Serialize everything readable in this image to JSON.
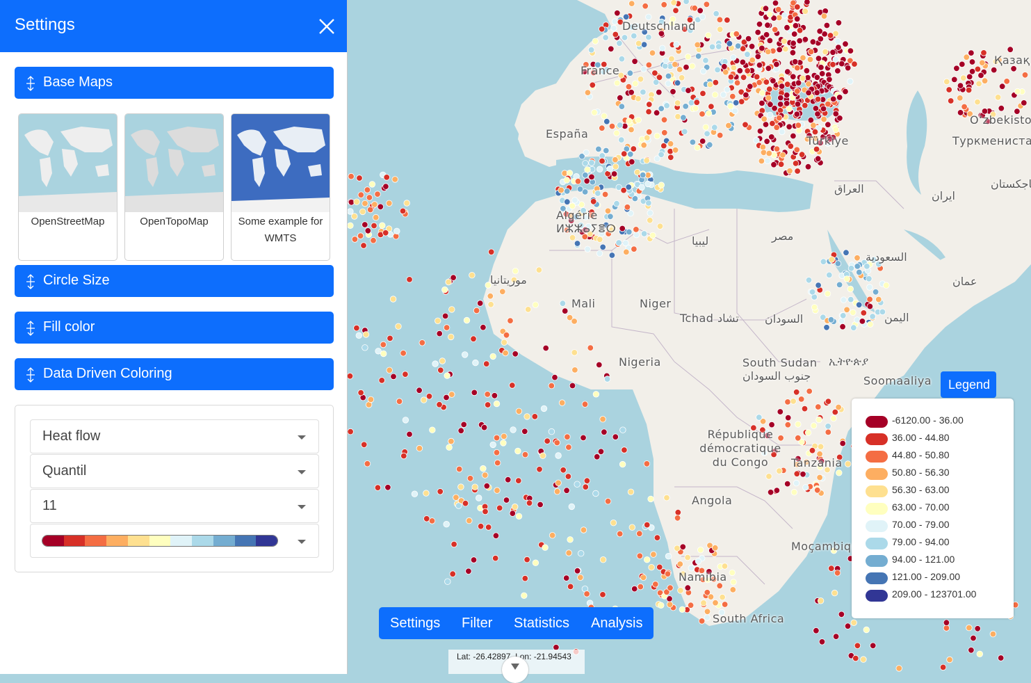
{
  "sidebar": {
    "title": "Settings",
    "sections": {
      "base_maps": "Base Maps",
      "circle_size": "Circle Size",
      "fill_color": "Fill color",
      "data_driven": "Data Driven Coloring"
    },
    "basemaps": [
      {
        "label": "OpenStreetMap"
      },
      {
        "label": "OpenTopoMap"
      },
      {
        "label": "Some example for WMTS"
      }
    ],
    "data_driven": {
      "attribute": "Heat flow",
      "classification": "Quantil",
      "classes": "11",
      "palette_colors": [
        "#a50026",
        "#d73027",
        "#f46d43",
        "#fdae61",
        "#fee090",
        "#ffffbf",
        "#e0f3f8",
        "#abd9e9",
        "#74add1",
        "#4575b4",
        "#313695"
      ]
    }
  },
  "tabs": [
    "Settings",
    "Filter",
    "Statistics",
    "Analysis"
  ],
  "coordinates": "Lat: -26.42897, Lon: -21.94543",
  "legend": {
    "button": "Legend",
    "items": [
      {
        "label": "-6120.00 - 36.00",
        "color": "#a50026"
      },
      {
        "label": "36.00 - 44.80",
        "color": "#d73027"
      },
      {
        "label": "44.80 - 50.80",
        "color": "#f46d43"
      },
      {
        "label": "50.80 - 56.30",
        "color": "#fdae61"
      },
      {
        "label": "56.30 - 63.00",
        "color": "#fee090"
      },
      {
        "label": "63.00 - 70.00",
        "color": "#ffffbf"
      },
      {
        "label": "70.00 - 79.00",
        "color": "#e0f3f8"
      },
      {
        "label": "79.00 - 94.00",
        "color": "#abd9e9"
      },
      {
        "label": "94.00 - 121.00",
        "color": "#74add1"
      },
      {
        "label": "121.00 - 209.00",
        "color": "#4575b4"
      },
      {
        "label": "209.00 - 123701.00",
        "color": "#313695"
      }
    ]
  },
  "map": {
    "places": [
      "Deutschland",
      "France",
      "España",
      "Türkiye",
      "Algérie ⵍⵣⵣⴰⵢⴻⵔ",
      "موريتانيا",
      "Mali",
      "Niger",
      "Tchad تشاد",
      "Nigeria",
      "ليبيا",
      "مصر",
      "السودان",
      "South Sudan جنوب السودان",
      "ኢትዮጵያ",
      "Soomaaliya",
      "République démocratique du Congo",
      "Tanzania",
      "Angola",
      "Namibia",
      "South Africa",
      "Moçambique",
      "العراق",
      "ایران",
      "السعودية",
      "عمان",
      "اليمن",
      "Oʻzbekiston",
      "Туркменистан",
      "تاجکستان",
      "Қазақ"
    ]
  }
}
